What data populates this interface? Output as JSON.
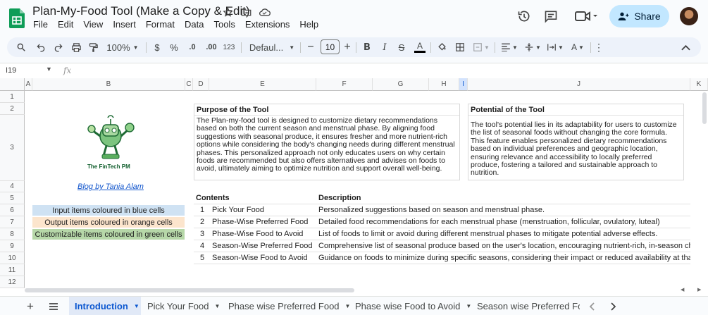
{
  "app": {
    "title": "Plan-My-Food Tool (Make a Copy & Edit)",
    "menu": [
      "File",
      "Edit",
      "View",
      "Insert",
      "Format",
      "Data",
      "Tools",
      "Extensions",
      "Help"
    ],
    "share_label": "Share",
    "accent": "#0b57d0",
    "brand_green": "#0f9d58"
  },
  "toolbar": {
    "zoom": "100%",
    "currency": "$",
    "percent": "%",
    "dec_dec": ".0",
    "dec_inc": ".00",
    "number_format": "123",
    "font": "Defaul...",
    "font_size": "10"
  },
  "formula_bar": {
    "cell_ref": "I19",
    "fx": "fx",
    "value": ""
  },
  "columns": [
    "A",
    "B",
    "C",
    "D",
    "E",
    "F",
    "G",
    "H",
    "I",
    "J",
    "K"
  ],
  "selected_column": "I",
  "rows": [
    "1",
    "2",
    "3",
    "4",
    "5",
    "6",
    "7",
    "8",
    "9",
    "10",
    "11",
    "12"
  ],
  "sheet": {
    "logo_caption": "The FinTech PM",
    "blog_link": "Blog by Tania Alam",
    "legend": [
      {
        "label": "Input items coloured in blue cells",
        "color": "#cfe2f3"
      },
      {
        "label": "Output items coloured in orange cells",
        "color": "#fce5cd"
      },
      {
        "label": "Customizable items coloured in green cells",
        "color": "#b6d7a8"
      }
    ],
    "purpose": {
      "title": "Purpose of the Tool",
      "body": "The Plan-my-food tool is designed to customize dietary recommendations based on both the current season and menstrual phase. By aligning food suggestions with seasonal produce, it ensures fresher and more nutrient-rich options while considering the body's changing needs during different menstrual phases. This personalized approach not only educates users on why certain foods are recommended but also offers alternatives and advises on foods to avoid, ultimately aiming to optimize nutrition and support overall well-being."
    },
    "potential": {
      "title": "Potential of the Tool",
      "body": "The tool's potential lies in its adaptability for users to customize the list of seasonal foods without changing the core formula. This feature enables personalized dietary recommendations based on individual preferences and geographic location, ensuring relevance and accessibility to locally preferred produce, fostering a tailored and sustainable approach to nutrition."
    },
    "contents_table": {
      "headers": [
        "Contents",
        "Description"
      ],
      "rows": [
        {
          "num": "1",
          "content": "Pick Your Food",
          "description": "Personalized suggestions based on season and menstrual phase."
        },
        {
          "num": "2",
          "content": "Phase-Wise Preferred Food",
          "description": "Detailed food recommendations for each menstrual phase (menstruation, follicular, ovulatory, luteal)"
        },
        {
          "num": "3",
          "content": "Phase-Wise Food to Avoid",
          "description": "List of foods to limit or avoid during different menstrual phases to mitigate potential adverse effects."
        },
        {
          "num": "4",
          "content": "Season-Wise Preferred Food",
          "description": "Comprehensive list of seasonal produce based on the user's location, encouraging nutrient-rich, in-season choices"
        },
        {
          "num": "5",
          "content": "Season-Wise Food to Avoid",
          "description": "Guidance on foods to minimize during specific seasons, considering their impact or reduced availability at that time"
        }
      ]
    }
  },
  "tabs": [
    {
      "label": "Introduction",
      "active": true
    },
    {
      "label": "Pick Your Food",
      "active": false
    },
    {
      "label": "Phase wise Preferred Food",
      "active": false
    },
    {
      "label": "Phase wise Food to Avoid",
      "active": false
    },
    {
      "label": "Season wise Preferred Foo",
      "active": false
    }
  ]
}
